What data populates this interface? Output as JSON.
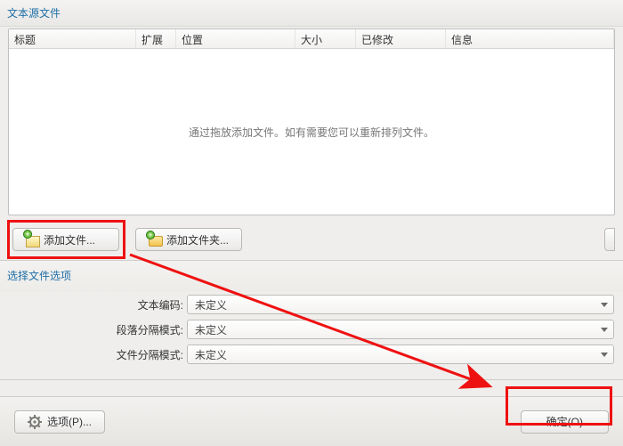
{
  "sections": {
    "source_title": "文本源文件",
    "options_title": "选择文件选项"
  },
  "columns": {
    "title": "标题",
    "ext": "扩展",
    "location": "位置",
    "size": "大小",
    "modified": "已修改",
    "info": "信息"
  },
  "placeholder": "通过拖放添加文件。如有需要您可以重新排列文件。",
  "buttons": {
    "add_file": "添加文件...",
    "add_folder": "添加文件夹...",
    "options": "选项(P)...",
    "ok": "确定(O)"
  },
  "form": {
    "encoding_label": "文本编码:",
    "para_label": "段落分隔模式:",
    "file_label": "文件分隔模式:",
    "undefined": "未定义"
  }
}
